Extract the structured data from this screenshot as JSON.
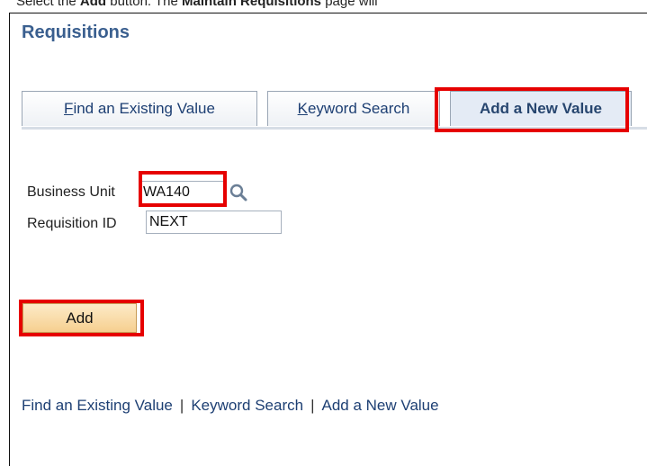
{
  "top_caption": {
    "prefix": "Select the ",
    "add_word": "Add",
    "middle": " button.  The ",
    "page_name": "Maintain Requisitions",
    "suffix": " page will"
  },
  "page": {
    "title": "Requisitions"
  },
  "tabs": [
    {
      "label_underlined": "F",
      "label_rest": "ind an Existing Value"
    },
    {
      "label_underlined": "K",
      "label_rest": "eyword Search"
    },
    {
      "label": "Add a New Value",
      "active": true
    }
  ],
  "form": {
    "business_unit": {
      "label": "Business Unit",
      "value": "WA140"
    },
    "requisition_id": {
      "label": "Requisition ID",
      "value": "NEXT"
    }
  },
  "add_button": {
    "label": "Add"
  },
  "bottom_links": [
    {
      "label": "Find an Existing Value"
    },
    {
      "label": "Keyword Search"
    },
    {
      "label": "Add a New Value"
    }
  ],
  "colors": {
    "title": "#3a5f8f",
    "link": "#1d3f73",
    "highlight": "#e60000",
    "button": "#f6cf8f"
  },
  "icons": {
    "lookup": "magnifier-icon"
  }
}
